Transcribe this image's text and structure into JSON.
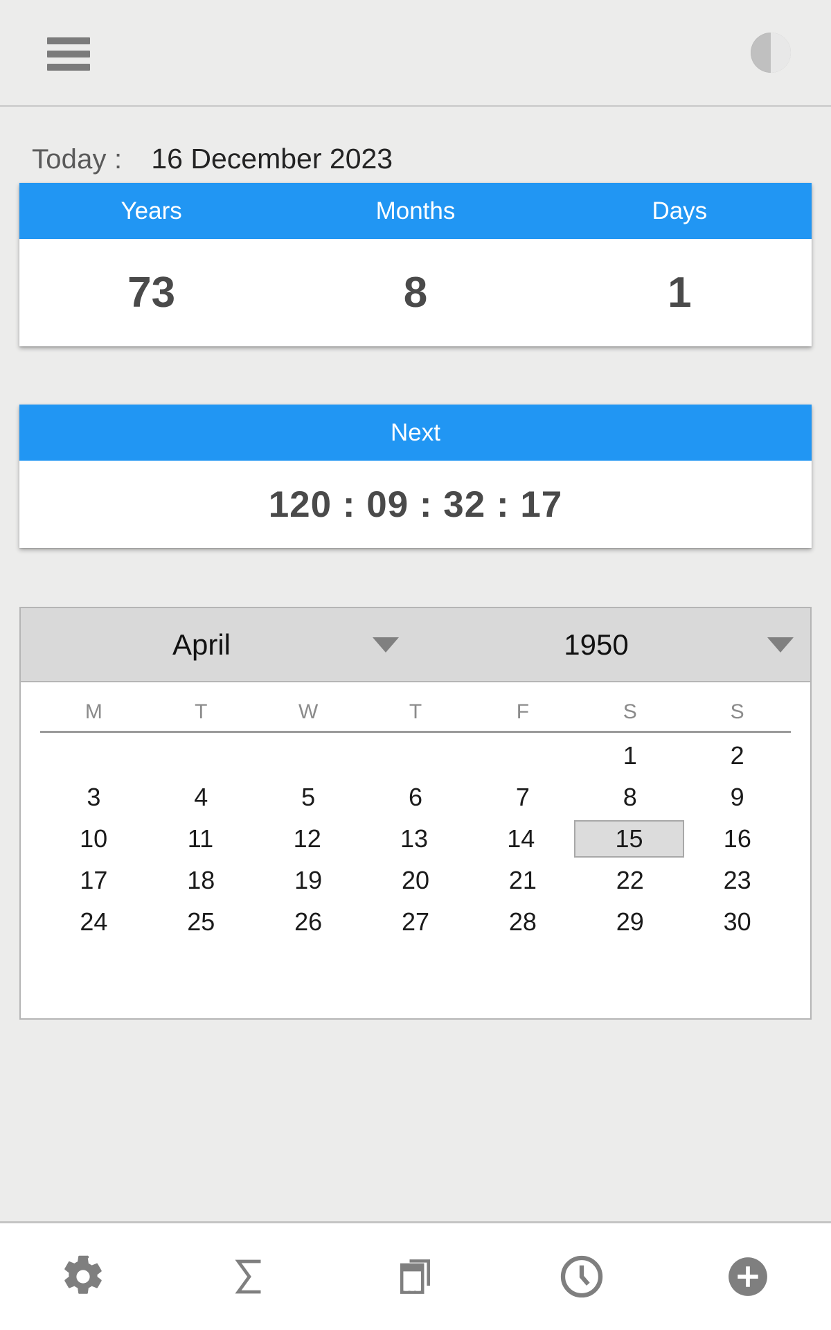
{
  "appbar": {
    "menu_icon": "hamburger-menu-icon",
    "theme_icon": "half-circle-contrast-icon"
  },
  "today": {
    "label": "Today :",
    "value": "16 December 2023"
  },
  "age_card": {
    "columns": [
      {
        "header": "Years",
        "value": "73"
      },
      {
        "header": "Months",
        "value": "8"
      },
      {
        "header": "Days",
        "value": "1"
      }
    ]
  },
  "next_card": {
    "header": "Next",
    "timer": "120 : 09 : 32 : 17"
  },
  "calendar": {
    "month": "April",
    "year": "1950",
    "month_caret_icon": "chevron-down-icon",
    "year_caret_icon": "chevron-down-icon",
    "weekdays": [
      "M",
      "T",
      "W",
      "T",
      "F",
      "S",
      "S"
    ],
    "selected_day": "15",
    "weeks": [
      [
        "",
        "",
        "",
        "",
        "",
        "1",
        "2"
      ],
      [
        "3",
        "4",
        "5",
        "6",
        "7",
        "8",
        "9"
      ],
      [
        "10",
        "11",
        "12",
        "13",
        "14",
        "15",
        "16"
      ],
      [
        "17",
        "18",
        "19",
        "20",
        "21",
        "22",
        "23"
      ],
      [
        "24",
        "25",
        "26",
        "27",
        "28",
        "29",
        "30"
      ],
      [
        "",
        "",
        "",
        "",
        "",
        "",
        ""
      ]
    ]
  },
  "bottom_nav": [
    {
      "icon": "gear-icon",
      "label": "Settings"
    },
    {
      "icon": "sigma-icon",
      "label": "Sum"
    },
    {
      "icon": "calendar-icon",
      "label": "Calendar"
    },
    {
      "icon": "clock-icon",
      "label": "Clock"
    },
    {
      "icon": "plus-circle-icon",
      "label": "Add"
    }
  ],
  "colors": {
    "accent": "#2196f3",
    "page_background": "#ececeb",
    "card_background": "#ffffff",
    "value_text": "#4a4a4a",
    "icon_gray": "#7b7b7b"
  }
}
